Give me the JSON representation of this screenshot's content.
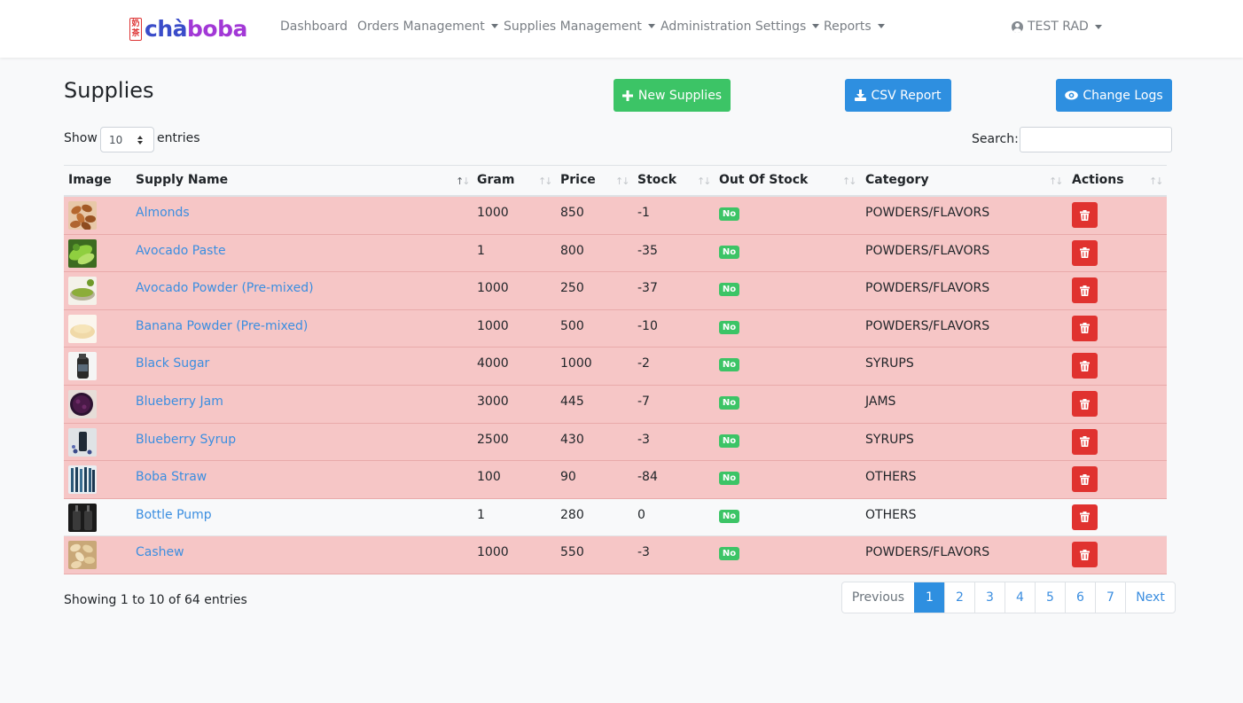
{
  "brand": {
    "seal_top": "奶",
    "seal_bottom": "茶",
    "name_cha": "chà",
    "name_boba": "boba"
  },
  "nav": {
    "dashboard": "Dashboard",
    "orders": "Orders Management",
    "supplies": "Supplies Management",
    "admin": "Administration Settings",
    "reports": "Reports",
    "user": "TEST RAD"
  },
  "page": {
    "title": "Supplies",
    "new_btn": "New Supplies",
    "csv_btn": "CSV Report",
    "logs_btn": "Change Logs",
    "show_label": "Show",
    "entries_value": "10",
    "entries_label": "entries",
    "search_label": "Search:",
    "search_value": ""
  },
  "table": {
    "headers": [
      "Image",
      "Supply Name",
      "Gram",
      "Price",
      "Stock",
      "Out Of Stock",
      "Category",
      "Actions"
    ],
    "rows": [
      {
        "image": "almonds",
        "name": "Almonds",
        "gram": "1000",
        "price": "850",
        "stock": "-1",
        "out": "No",
        "category": "POWDERS/FLAVORS"
      },
      {
        "image": "avocado-paste",
        "name": "Avocado Paste",
        "gram": "1",
        "price": "800",
        "stock": "-35",
        "out": "No",
        "category": "POWDERS/FLAVORS"
      },
      {
        "image": "avocado-powder",
        "name": "Avocado Powder (Pre-mixed)",
        "gram": "1000",
        "price": "250",
        "stock": "-37",
        "out": "No",
        "category": "POWDERS/FLAVORS"
      },
      {
        "image": "banana-powder",
        "name": "Banana Powder (Pre-mixed)",
        "gram": "1000",
        "price": "500",
        "stock": "-10",
        "out": "No",
        "category": "POWDERS/FLAVORS"
      },
      {
        "image": "black-sugar",
        "name": "Black Sugar",
        "gram": "4000",
        "price": "1000",
        "stock": "-2",
        "out": "No",
        "category": "SYRUPS"
      },
      {
        "image": "blueberry-jam",
        "name": "Blueberry Jam",
        "gram": "3000",
        "price": "445",
        "stock": "-7",
        "out": "No",
        "category": "JAMS"
      },
      {
        "image": "blueberry-syrup",
        "name": "Blueberry Syrup",
        "gram": "2500",
        "price": "430",
        "stock": "-3",
        "out": "No",
        "category": "SYRUPS"
      },
      {
        "image": "boba-straw",
        "name": "Boba Straw",
        "gram": "100",
        "price": "90",
        "stock": "-84",
        "out": "No",
        "category": "OTHERS"
      },
      {
        "image": "bottle-pump",
        "name": "Bottle Pump",
        "gram": "1",
        "price": "280",
        "stock": "0",
        "out": "No",
        "category": "OTHERS"
      },
      {
        "image": "cashew",
        "name": "Cashew",
        "gram": "1000",
        "price": "550",
        "stock": "-3",
        "out": "No",
        "category": "POWDERS/FLAVORS"
      }
    ]
  },
  "footer": {
    "info": "Showing 1 to 10 of 64 entries",
    "prev": "Previous",
    "pages": [
      "1",
      "2",
      "3",
      "4",
      "5",
      "6",
      "7"
    ],
    "active_page": "1",
    "next": "Next"
  },
  "colors": {
    "low_stock_row": "#f6c6c6",
    "normal_row": "#f8f9fa",
    "green": "#3cc466",
    "blue": "#2e8fe0",
    "danger": "#e0322f",
    "link": "#3b8ee0"
  }
}
